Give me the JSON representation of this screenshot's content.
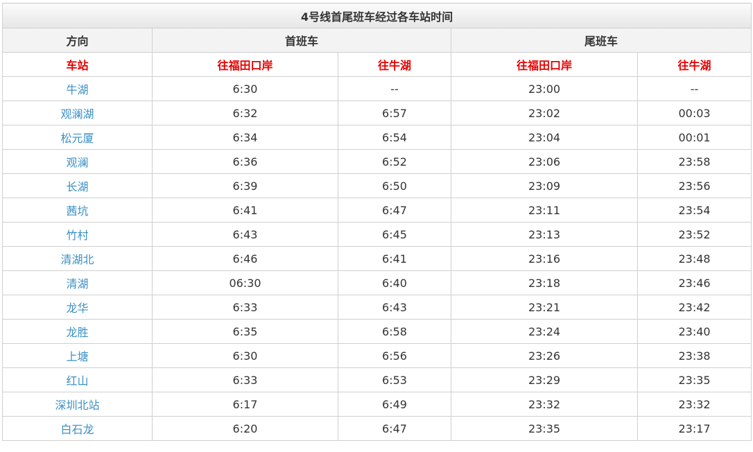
{
  "table": {
    "title": "4号线首尾班车经过各车站时间",
    "direction_label": "方向",
    "first_train_label": "首班车",
    "last_train_label": "尾班车",
    "station_label": "车站",
    "to_futian": "往福田口岸",
    "to_niuhu": "往牛湖",
    "rows": [
      {
        "station": "牛湖",
        "first_futian": "6:30",
        "first_niuhu": "--",
        "last_futian": "23:00",
        "last_niuhu": "--"
      },
      {
        "station": "观澜湖",
        "first_futian": "6:32",
        "first_niuhu": "6:57",
        "last_futian": "23:02",
        "last_niuhu": "00:03"
      },
      {
        "station": "松元厦",
        "first_futian": "6:34",
        "first_niuhu": "6:54",
        "last_futian": "23:04",
        "last_niuhu": "00:01"
      },
      {
        "station": "观澜",
        "first_futian": "6:36",
        "first_niuhu": "6:52",
        "last_futian": "23:06",
        "last_niuhu": "23:58"
      },
      {
        "station": "长湖",
        "first_futian": "6:39",
        "first_niuhu": "6:50",
        "last_futian": "23:09",
        "last_niuhu": "23:56"
      },
      {
        "station": "茜坑",
        "first_futian": "6:41",
        "first_niuhu": "6:47",
        "last_futian": "23:11",
        "last_niuhu": "23:54"
      },
      {
        "station": "竹村",
        "first_futian": "6:43",
        "first_niuhu": "6:45",
        "last_futian": "23:13",
        "last_niuhu": "23:52"
      },
      {
        "station": "清湖北",
        "first_futian": "6:46",
        "first_niuhu": "6:41",
        "last_futian": "23:16",
        "last_niuhu": "23:48"
      },
      {
        "station": "清湖",
        "first_futian": "06:30",
        "first_niuhu": "6:40",
        "last_futian": "23:18",
        "last_niuhu": "23:46"
      },
      {
        "station": "龙华",
        "first_futian": "6:33",
        "first_niuhu": "6:43",
        "last_futian": "23:21",
        "last_niuhu": "23:42"
      },
      {
        "station": "龙胜",
        "first_futian": "6:35",
        "first_niuhu": "6:58",
        "last_futian": "23:24",
        "last_niuhu": "23:40"
      },
      {
        "station": "上塘",
        "first_futian": "6:30",
        "first_niuhu": "6:56",
        "last_futian": "23:26",
        "last_niuhu": "23:38"
      },
      {
        "station": "红山",
        "first_futian": "6:33",
        "first_niuhu": "6:53",
        "last_futian": "23:29",
        "last_niuhu": "23:35"
      },
      {
        "station": "深圳北站",
        "first_futian": "6:17",
        "first_niuhu": "6:49",
        "last_futian": "23:32",
        "last_niuhu": "23:32"
      },
      {
        "station": "白石龙",
        "first_futian": "6:20",
        "first_niuhu": "6:47",
        "last_futian": "23:35",
        "last_niuhu": "23:17"
      }
    ]
  }
}
